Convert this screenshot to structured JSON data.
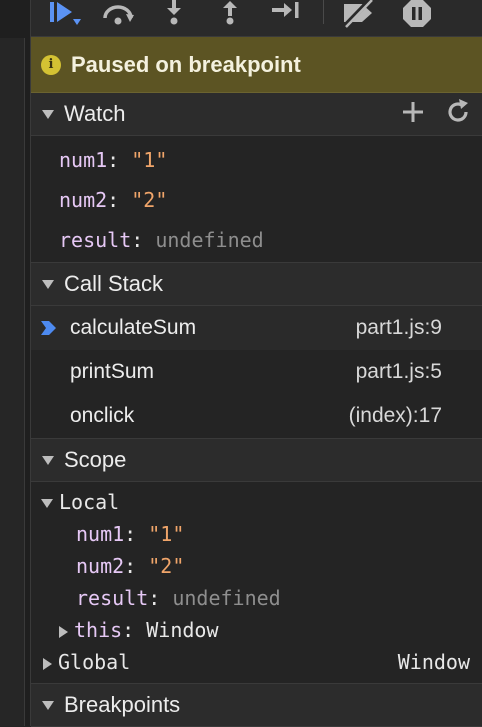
{
  "banner": {
    "text": "Paused on breakpoint",
    "info_glyph": "i"
  },
  "sections": {
    "watch": "Watch",
    "call_stack": "Call Stack",
    "scope": "Scope",
    "breakpoints": "Breakpoints"
  },
  "watch": {
    "items": [
      {
        "name": "num1",
        "sep": ": ",
        "value": "\"1\""
      },
      {
        "name": "num2",
        "sep": ": ",
        "value": "\"2\""
      },
      {
        "name": "result",
        "sep": ": ",
        "value": "undefined"
      }
    ]
  },
  "call_stack": {
    "frames": [
      {
        "fn": "calculateSum",
        "loc": "part1.js:9"
      },
      {
        "fn": "printSum",
        "loc": "part1.js:5"
      },
      {
        "fn": "onclick",
        "loc": "(index):17"
      }
    ]
  },
  "scope": {
    "local_label": "Local",
    "local": [
      {
        "name": "num1",
        "sep": ": ",
        "value": "\"1\""
      },
      {
        "name": "num2",
        "sep": ": ",
        "value": "\"2\""
      },
      {
        "name": "result",
        "sep": ": ",
        "value": "undefined"
      }
    ],
    "this_name": "this",
    "this_sep": ": ",
    "this_value": "Window",
    "global_label": "Global",
    "global_value": "Window"
  },
  "colors": {
    "banner_bg": "#5c5423",
    "string_value": "#f0a56a",
    "property_name": "#e6c8f5",
    "active_frame_arrow": "#4d8af0",
    "resume_icon": "#5b93f5"
  }
}
